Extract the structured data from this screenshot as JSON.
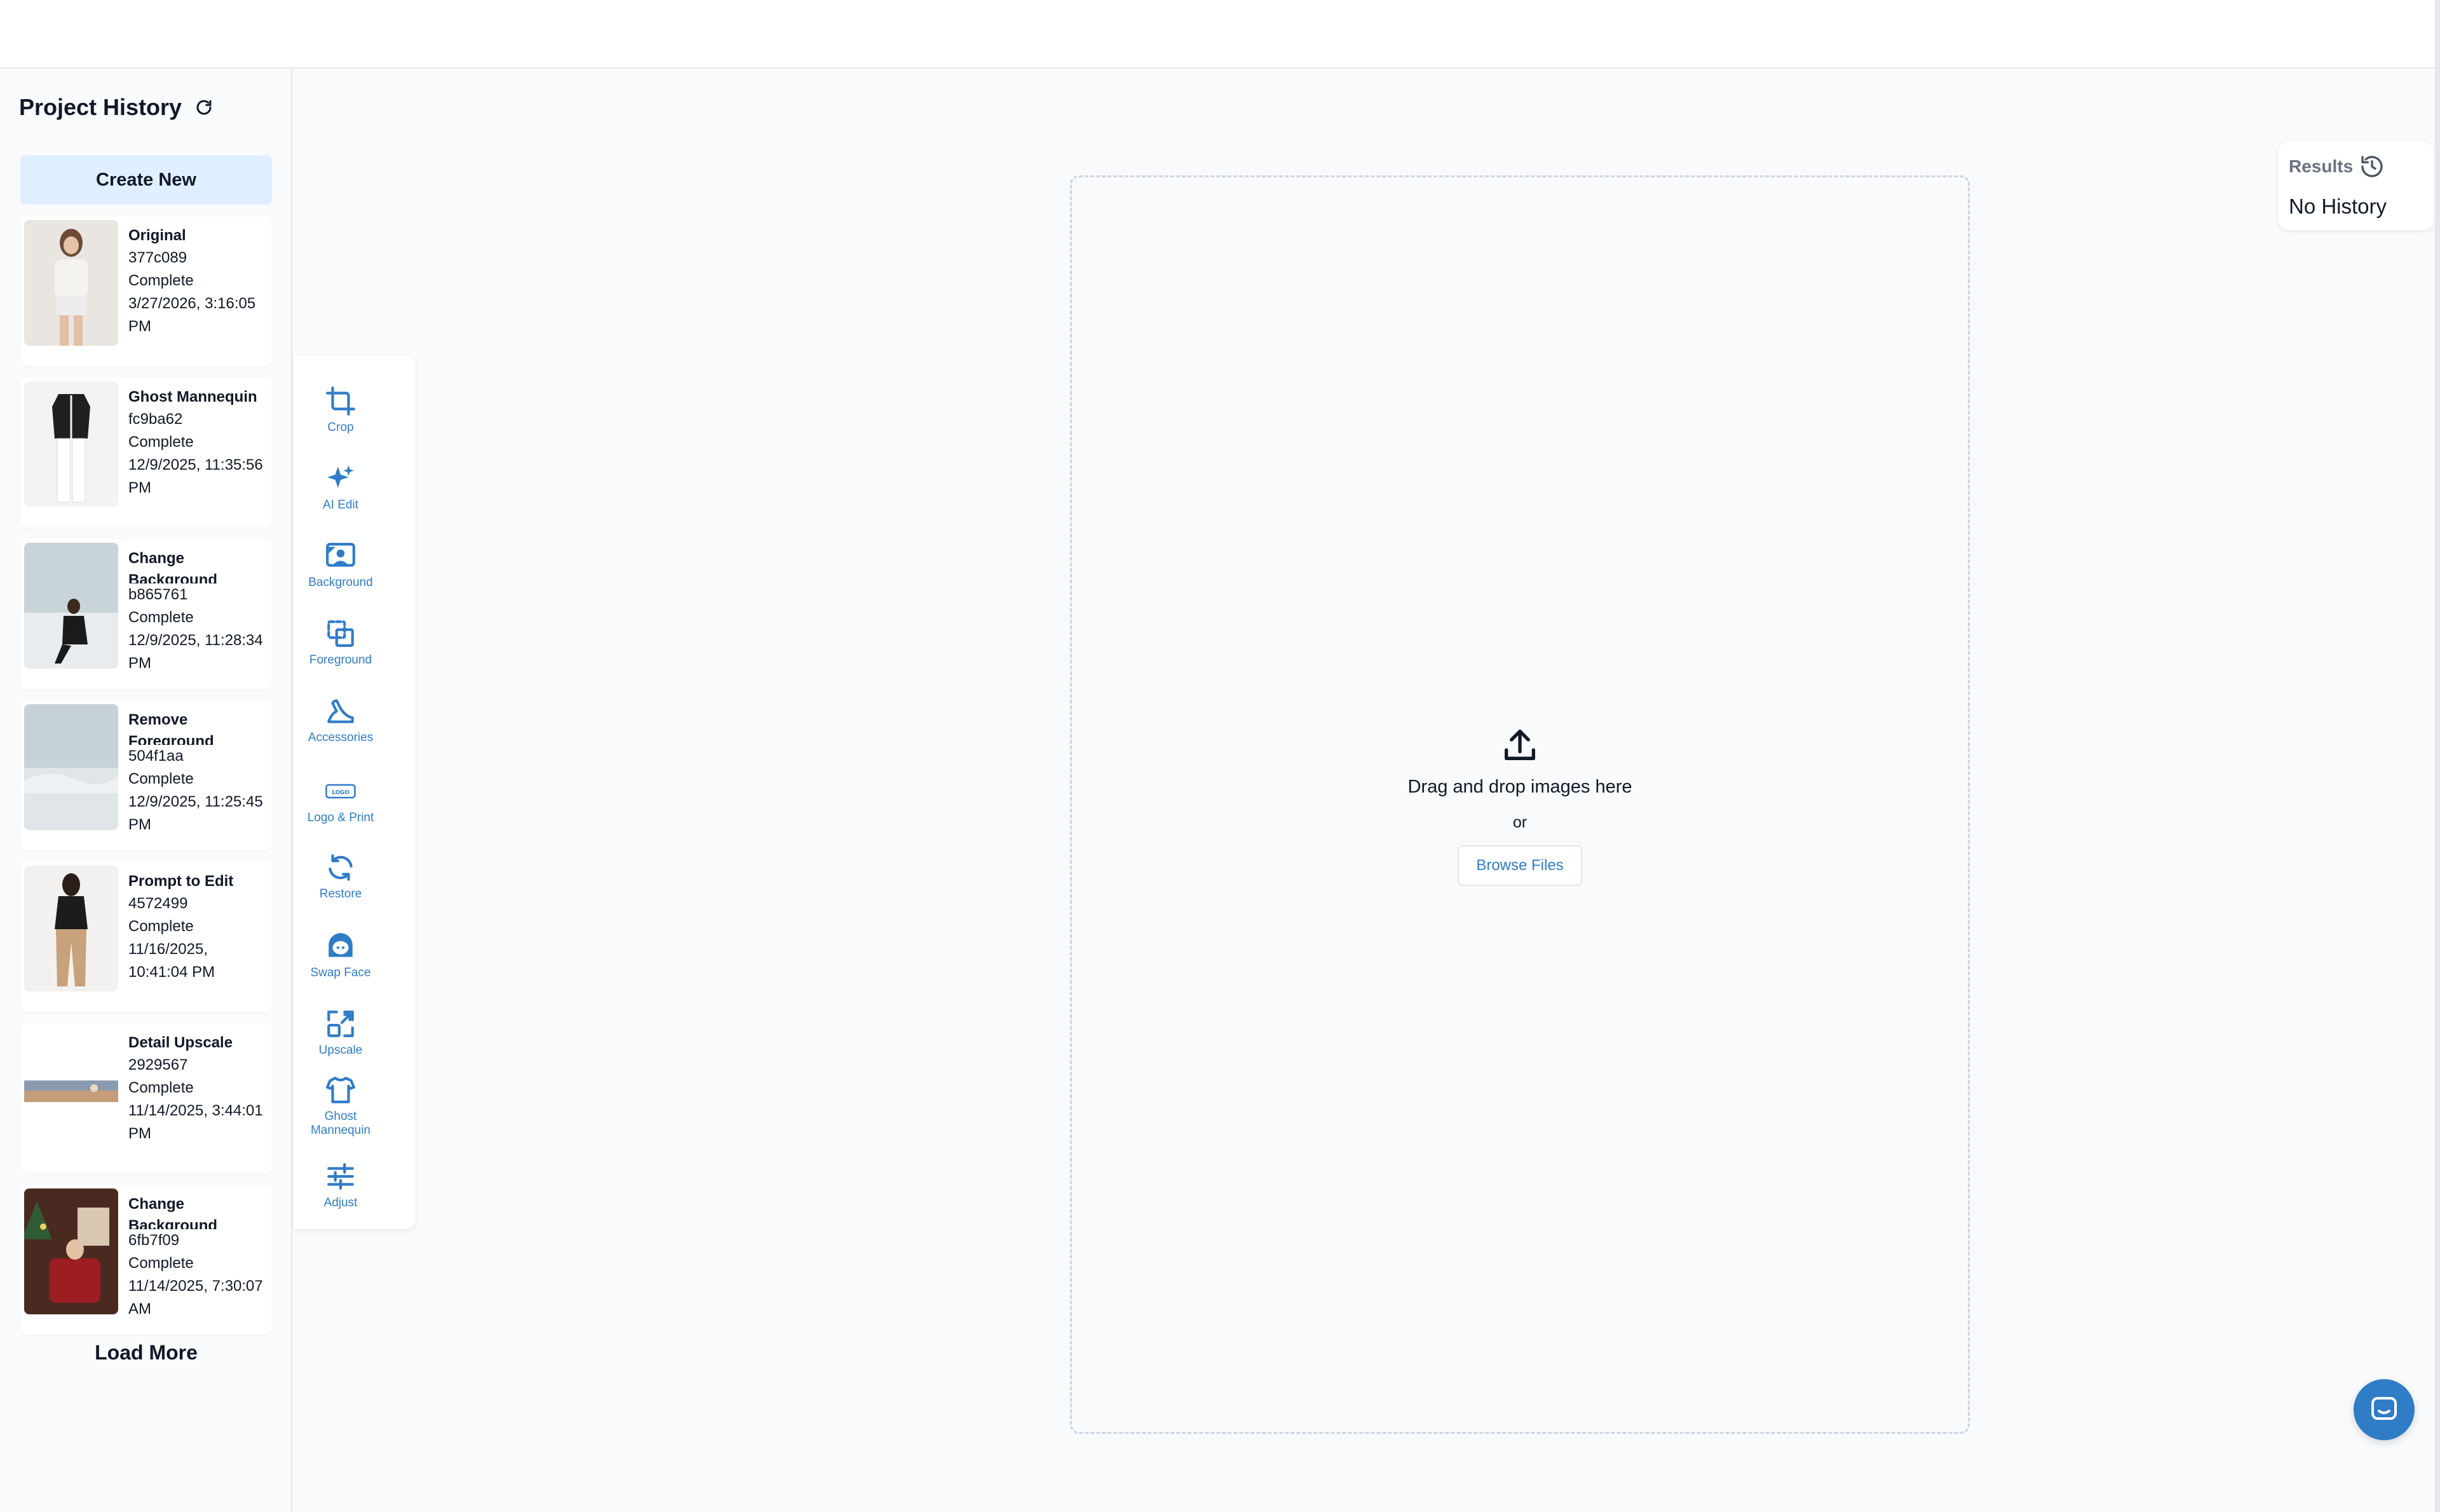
{
  "sidebar": {
    "title": "Project History",
    "create_label": "Create New",
    "load_more_label": "Load More",
    "items": [
      {
        "title": "Original",
        "id": "377c089",
        "status": "Complete",
        "date": "3/27/2026, 3:16:05 PM"
      },
      {
        "title": "Ghost Mannequin",
        "id": "fc9ba62",
        "status": "Complete",
        "date": "12/9/2025, 11:35:56 PM"
      },
      {
        "title": "Change Background",
        "id": "b865761",
        "status": "Complete",
        "date": "12/9/2025, 11:28:34 PM"
      },
      {
        "title": "Remove Foreground",
        "id": "504f1aa",
        "status": "Complete",
        "date": "12/9/2025, 11:25:45 PM"
      },
      {
        "title": "Prompt to Edit",
        "id": "4572499",
        "status": "Complete",
        "date": "11/16/2025, 10:41:04 PM"
      },
      {
        "title": "Detail Upscale",
        "id": "2929567",
        "status": "Complete",
        "date": "11/14/2025, 3:44:01 PM"
      },
      {
        "title": "Change Background",
        "id": "6fb7f09",
        "status": "Complete",
        "date": "11/14/2025, 7:30:07 AM"
      }
    ]
  },
  "tools": [
    {
      "label": "Crop",
      "icon": "crop-icon"
    },
    {
      "label": "AI Edit",
      "icon": "sparkles-icon"
    },
    {
      "label": "Background",
      "icon": "background-icon"
    },
    {
      "label": "Foreground",
      "icon": "foreground-icon"
    },
    {
      "label": "Accessories",
      "icon": "shoe-icon"
    },
    {
      "label": "Logo & Print",
      "icon": "logo-icon",
      "badge": "LOGO"
    },
    {
      "label": "Restore",
      "icon": "restore-icon"
    },
    {
      "label": "Swap Face",
      "icon": "face-icon"
    },
    {
      "label": "Upscale",
      "icon": "upscale-icon"
    },
    {
      "label": "Ghost Mannequin",
      "icon": "shirt-icon"
    },
    {
      "label": "Adjust",
      "icon": "sliders-icon"
    }
  ],
  "dropzone": {
    "text": "Drag and drop images here",
    "or": "or",
    "browse_label": "Browse Files"
  },
  "results": {
    "label": "Results",
    "empty": "No History"
  },
  "colors": {
    "accent": "#2f7cc7",
    "create_bg": "#e0efff"
  }
}
